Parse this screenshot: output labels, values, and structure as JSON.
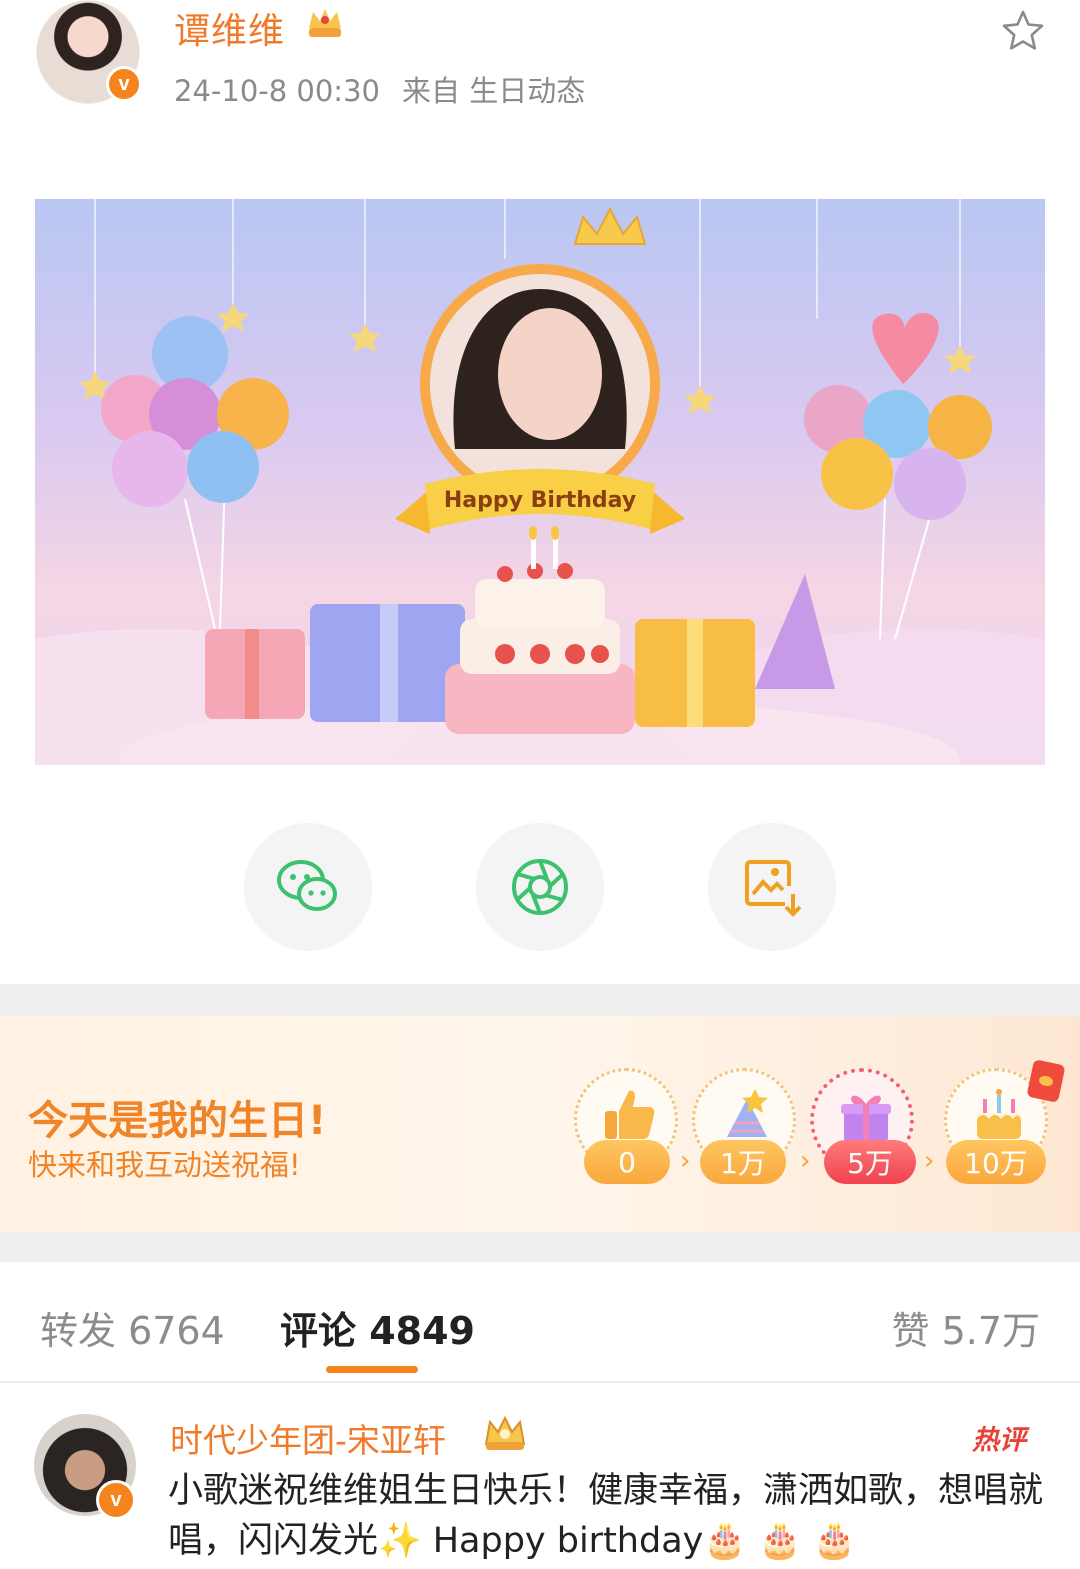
{
  "post": {
    "author": "谭维维",
    "time": "24-10-8 00:30",
    "source": "来自 生日动态"
  },
  "banner": {
    "ribbon_text": "Happy Birthday"
  },
  "share": {
    "icons": [
      "wechat-icon",
      "moments-icon",
      "save-image-icon"
    ]
  },
  "birthday": {
    "title": "今天是我的生日!",
    "subtitle": "快来和我互动送祝福!",
    "milestones": [
      "0",
      "1万",
      "5万",
      "10万"
    ]
  },
  "tabs": {
    "repost": "转发 6764",
    "comments": "评论 4849",
    "likes": "赞 5.7万"
  },
  "comment": {
    "author": "时代少年团-宋亚轩",
    "badge": "热评",
    "text": "小歌迷祝维维姐生日快乐！健康幸福，潇洒如歌，想唱就唱，闪闪发光✨ Happy birthday🎂 🎂 🎂"
  },
  "colors": {
    "accent": "#f5841f",
    "name": "#f07a2a",
    "hot": "#e8413a"
  }
}
